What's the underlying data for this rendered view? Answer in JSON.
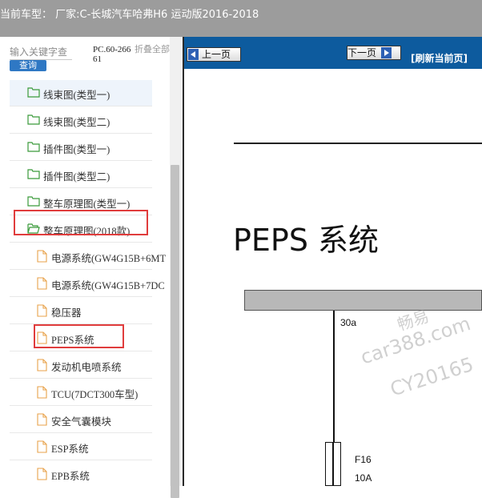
{
  "title_bar": {
    "text": "当前车型：  厂家:C-长城汽车哈弗H6 运动版2016-2018"
  },
  "sidebar": {
    "search": {
      "placeholder": "输入关键字查",
      "button_label": "查询"
    },
    "pc_code": "PC.60-26661",
    "collapse_all_label": "折叠全部",
    "items": [
      {
        "label": "线束图(类型一)",
        "type": "folder",
        "icon": "folder-icon"
      },
      {
        "label": "线束图(类型二)",
        "type": "folder",
        "icon": "folder-icon"
      },
      {
        "label": "插件图(类型一)",
        "type": "folder",
        "icon": "folder-icon"
      },
      {
        "label": "插件图(类型二)",
        "type": "folder",
        "icon": "folder-icon"
      },
      {
        "label": "整车原理图(类型一)",
        "type": "folder",
        "icon": "folder-icon"
      },
      {
        "label": "整车原理图(2018款)",
        "type": "folder",
        "icon": "folder-open-icon",
        "expanded": true
      },
      {
        "label": "电源系统(GW4G15B+6MT",
        "type": "file",
        "icon": "document-icon"
      },
      {
        "label": "电源系统(GW4G15B+7DC",
        "type": "file",
        "icon": "document-icon"
      },
      {
        "label": "稳压器",
        "type": "file",
        "icon": "document-icon"
      },
      {
        "label": "PEPS系统",
        "type": "file",
        "icon": "document-icon",
        "selected": true
      },
      {
        "label": "发动机电喷系统",
        "type": "file",
        "icon": "document-icon"
      },
      {
        "label": "TCU(7DCT300车型)",
        "type": "file",
        "icon": "document-icon"
      },
      {
        "label": "安全气囊模块",
        "type": "file",
        "icon": "document-icon"
      },
      {
        "label": "ESP系统",
        "type": "file",
        "icon": "document-icon"
      },
      {
        "label": "EPB系统",
        "type": "file",
        "icon": "document-icon"
      }
    ]
  },
  "viewer": {
    "prev_label": "上一页",
    "next_label": "下一页",
    "refresh_label": "[刷新当前页]",
    "page_title": "PEPS 系统",
    "labels": {
      "supply": "30a",
      "fuse": "F16",
      "fuse_rating": "10A"
    },
    "watermark": [
      "畅易",
      "car388.com",
      "CY20165"
    ]
  },
  "colors": {
    "title_bar": "#9c9c9c",
    "nav_bar": "#0d5b9e",
    "query_button": "#2f78c4",
    "highlight": "#e03c3c",
    "folder_icon": "#3a9a3a",
    "file_icon": "#e8a24a"
  }
}
